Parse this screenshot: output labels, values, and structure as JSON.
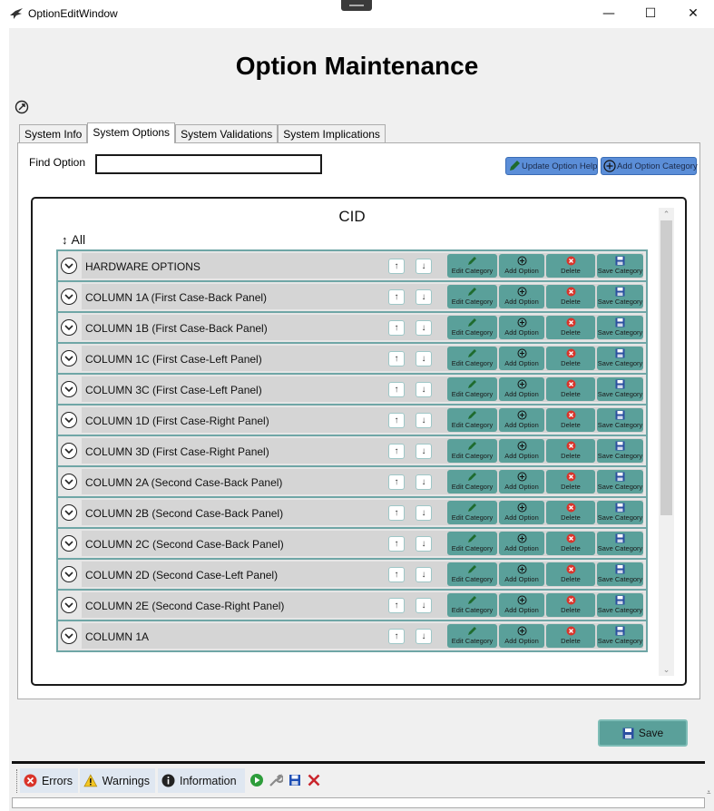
{
  "window": {
    "title": "OptionEditWindow",
    "minimize_glyph": "—",
    "maximize_glyph": "☐",
    "close_glyph": "✕"
  },
  "page_title": "Option Maintenance",
  "tabs": [
    {
      "label": "System Info",
      "active": false
    },
    {
      "label": "System Options",
      "active": true
    },
    {
      "label": "System Validations",
      "active": false
    },
    {
      "label": "System Implications",
      "active": false
    }
  ],
  "find": {
    "label": "Find Option",
    "value": ""
  },
  "buttons": {
    "update_help": "Update Option Help",
    "add_category": "Add Option Category",
    "save": "Save"
  },
  "cid_title": "CID",
  "all_label": "All",
  "row_actions": {
    "up_glyph": "↑",
    "down_glyph": "↓",
    "edit": "Edit Category",
    "add": "Add Option",
    "delete": "Delete",
    "save": "Save Category"
  },
  "categories": [
    "HARDWARE OPTIONS",
    "COLUMN 1A (First Case-Back Panel)",
    "COLUMN 1B (First Case-Back Panel)",
    "COLUMN 1C (First Case-Left Panel)",
    "COLUMN 3C (First Case-Left Panel)",
    "COLUMN 1D (First Case-Right Panel)",
    "COLUMN 3D (First Case-Right Panel)",
    "COLUMN 2A (Second Case-Back Panel)",
    "COLUMN 2B (Second Case-Back Panel)",
    "COLUMN 2C (Second Case-Back Panel)",
    "COLUMN 2D (Second Case-Left Panel)",
    "COLUMN 2E (Second Case-Right Panel)",
    "COLUMN 1A"
  ],
  "status": {
    "errors": "Errors",
    "warnings": "Warnings",
    "information": "Information"
  },
  "colors": {
    "action_teal": "#5aa09a",
    "row_border": "#6fa6a6",
    "top_button_blue": "#5b8ed8",
    "status_tab": "#dfe7f1"
  }
}
